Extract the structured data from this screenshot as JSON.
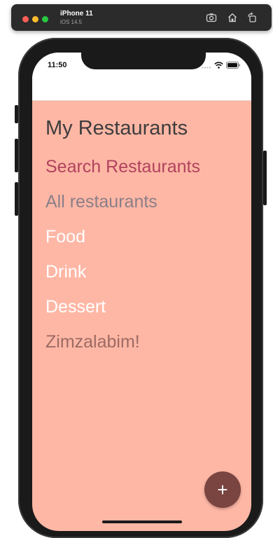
{
  "simulator": {
    "device_name": "iPhone 11",
    "os_version": "iOS 14.5",
    "icons": [
      "screenshot-icon",
      "home-icon",
      "rotate-icon"
    ]
  },
  "status_bar": {
    "time": "11:50",
    "icons": [
      "cellular-icon",
      "wifi-icon",
      "battery-icon"
    ]
  },
  "app": {
    "title": "My Restaurants",
    "menu": [
      {
        "label": "Search Restaurants",
        "color": "#B0425E"
      },
      {
        "label": "All restaurants",
        "color": "#8A7F88"
      },
      {
        "label": "Food",
        "color": "#FFFFFF"
      },
      {
        "label": "Drink",
        "color": "#FFFFFF"
      },
      {
        "label": "Dessert",
        "color": "#FFFFFF"
      },
      {
        "label": "Zimzalabim!",
        "color": "#9C6B64"
      }
    ],
    "fab_label": "+",
    "colors": {
      "background": "#FFB7A5",
      "fab": "#7A4440",
      "title": "#3D3D3D"
    }
  }
}
